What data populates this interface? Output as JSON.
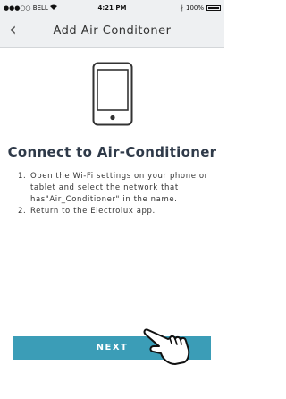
{
  "status_bar": {
    "carrier": "●●●○○ BELL",
    "time": "4:21 PM",
    "battery": "100%"
  },
  "nav": {
    "title": "Add Air Conditoner"
  },
  "main": {
    "heading": "Connect to Air-Conditioner",
    "steps": [
      {
        "num": "1.",
        "text": "Open the Wi-Fi settings on your phone or tablet and select the network that has\"Air_Conditioner\" in the name."
      },
      {
        "num": "2.",
        "text": "Return to the Electrolux app."
      }
    ]
  },
  "footer": {
    "next_label": "NEXT"
  },
  "colors": {
    "accent": "#3b9db7",
    "heading": "#2f3a49"
  }
}
